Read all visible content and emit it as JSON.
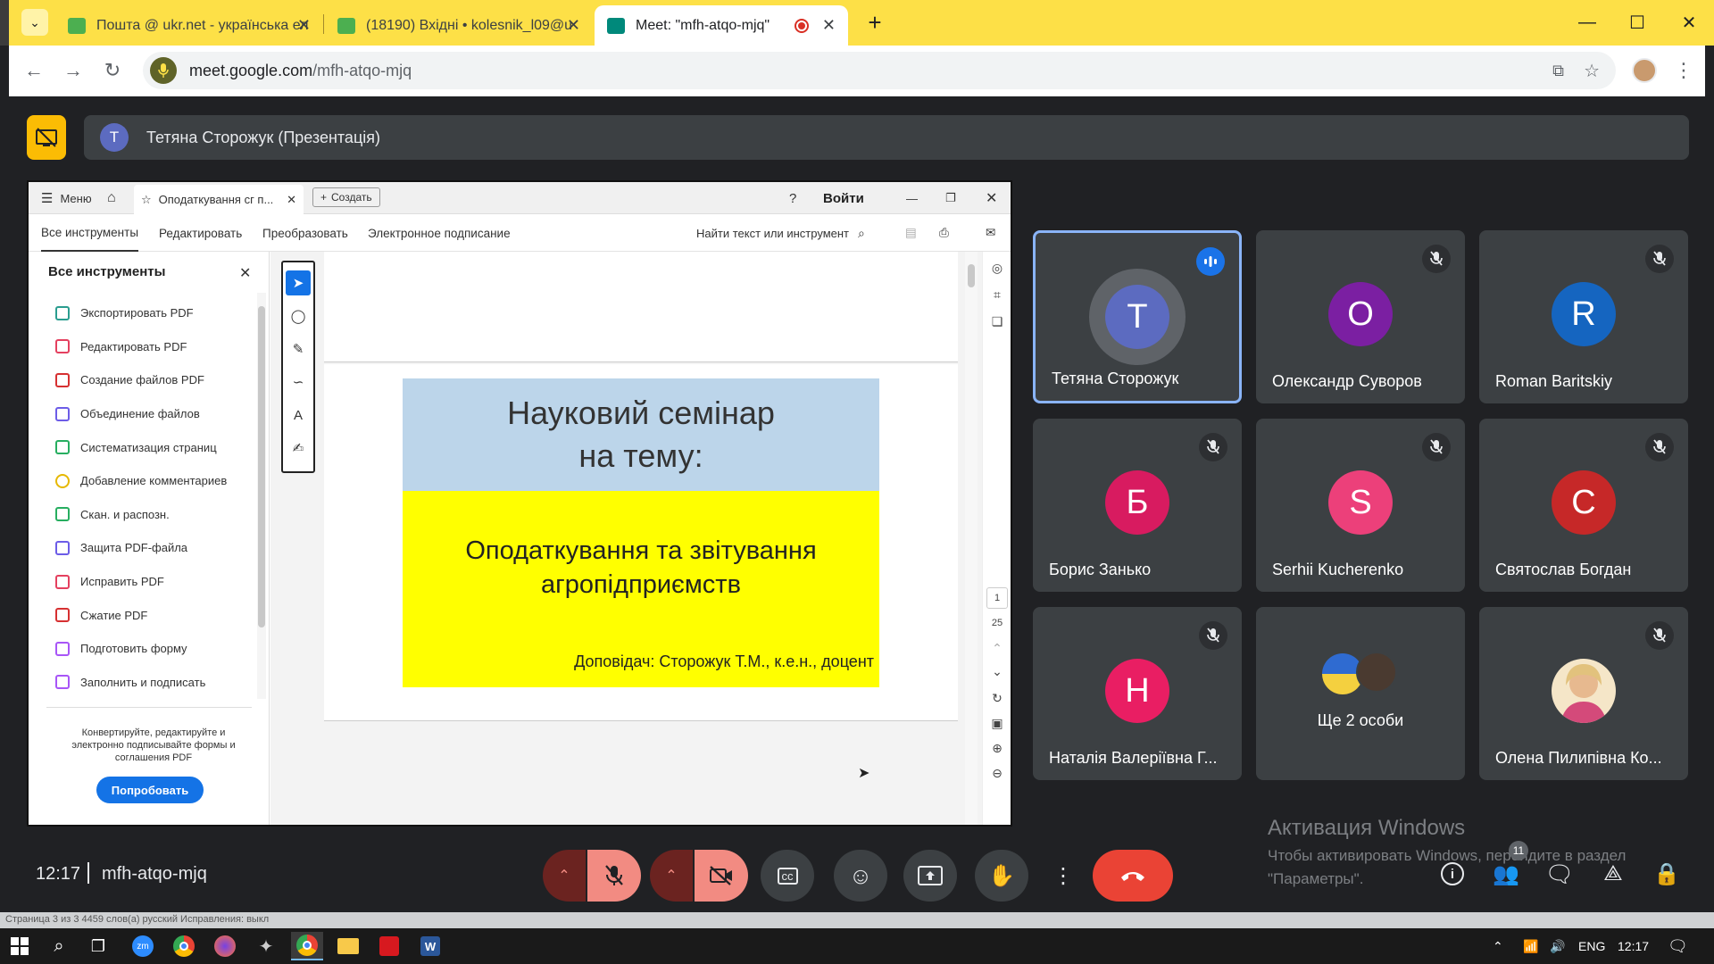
{
  "browser": {
    "tabs": [
      {
        "title": "Пошта @ ukr.net - українська ел",
        "favicon_color": "#4caf50"
      },
      {
        "title": "(18190) Вхідні • kolesnik_l09@u",
        "favicon_color": "#4caf50"
      },
      {
        "title": "Meet: \"mfh-atqo-mjq\"",
        "favicon_color": "#00897b"
      }
    ],
    "new_tab": "+",
    "url_host": "meet.google.com",
    "url_path": "/mfh-atqo-mjq",
    "accent": "#fde047"
  },
  "meet": {
    "presenter_initial": "Т",
    "presenter_label": "Тетяна Сторожук (Презентація)",
    "participants": [
      {
        "initial": "Т",
        "name": "Тетяна Сторожук",
        "color": "#5c6bc0",
        "speaking": true
      },
      {
        "initial": "О",
        "name": "Олександр Суворов",
        "color": "#7b1fa2",
        "speaking": false
      },
      {
        "initial": "R",
        "name": "Roman Baritskiy",
        "color": "#1565c0",
        "speaking": false
      },
      {
        "initial": "Б",
        "name": "Борис Занько",
        "color": "#d81b60",
        "speaking": false
      },
      {
        "initial": "S",
        "name": "Serhii Kucherenko",
        "color": "#ec407a",
        "speaking": false
      },
      {
        "initial": "С",
        "name": "Святослав Богдан",
        "color": "#c62828",
        "speaking": false
      },
      {
        "initial": "Н",
        "name": "Наталія Валеріївна Г...",
        "color": "#e91e63",
        "speaking": false
      },
      {
        "initial": "",
        "name": "Ще 2 особи",
        "color": "#3c4043",
        "speaking": false
      },
      {
        "initial": "",
        "name": "Олена Пилипівна Ко...",
        "color": "#f5e6c8",
        "speaking": false
      }
    ],
    "time": "12:17",
    "meeting_code": "mfh-atqo-mjq",
    "people_count": "11"
  },
  "acrobat": {
    "menu": "Меню",
    "tab_title": "Оподаткування сг п...",
    "create": "Создать",
    "signin": "Войти",
    "menu_tabs": [
      "Все инструменты",
      "Редактировать",
      "Преобразовать",
      "Электронное подписание"
    ],
    "search": "Найти текст или инструмент",
    "panel_title": "Все инструменты",
    "tools": [
      {
        "label": "Экспортировать PDF",
        "color": "#2a9d8f"
      },
      {
        "label": "Редактировать PDF",
        "color": "#e4405f"
      },
      {
        "label": "Создание файлов PDF",
        "color": "#d63031"
      },
      {
        "label": "Объединение файлов",
        "color": "#6c5ce7"
      },
      {
        "label": "Систематизация страниц",
        "color": "#27ae60"
      },
      {
        "label": "Добавление комментариев",
        "color": "#e6b800"
      },
      {
        "label": "Скан. и распозн.",
        "color": "#27ae60"
      },
      {
        "label": "Защита PDF-файла",
        "color": "#6c5ce7"
      },
      {
        "label": "Исправить PDF",
        "color": "#e4405f"
      },
      {
        "label": "Сжатие PDF",
        "color": "#d63031"
      },
      {
        "label": "Подготовить форму",
        "color": "#a855f7"
      },
      {
        "label": "Заполнить и подписать",
        "color": "#a855f7"
      }
    ],
    "promo": "Конвертируйте, редактируйте и электронно подписывайте формы и соглашения PDF",
    "try_btn": "Попробовать",
    "page_current": "1",
    "page_total": "25"
  },
  "slide": {
    "title_line1": "Науковий семінар",
    "title_line2": "на тему:",
    "topic_line1": "Оподаткування та звітування",
    "topic_line2": "агропідприємств",
    "reporter": "Доповідач: Сторожук Т.М., к.е.н., доцент"
  },
  "watermark": {
    "title": "Активация Windows",
    "line1": "Чтобы активировать Windows, перейдите в раздел",
    "line2": "\"Параметры\"."
  },
  "taskbar": {
    "lang": "ENG",
    "time": "12:17"
  },
  "word_status": "Страница 3 из 3   4459 слов(а)   русский   Исправления: выкл"
}
